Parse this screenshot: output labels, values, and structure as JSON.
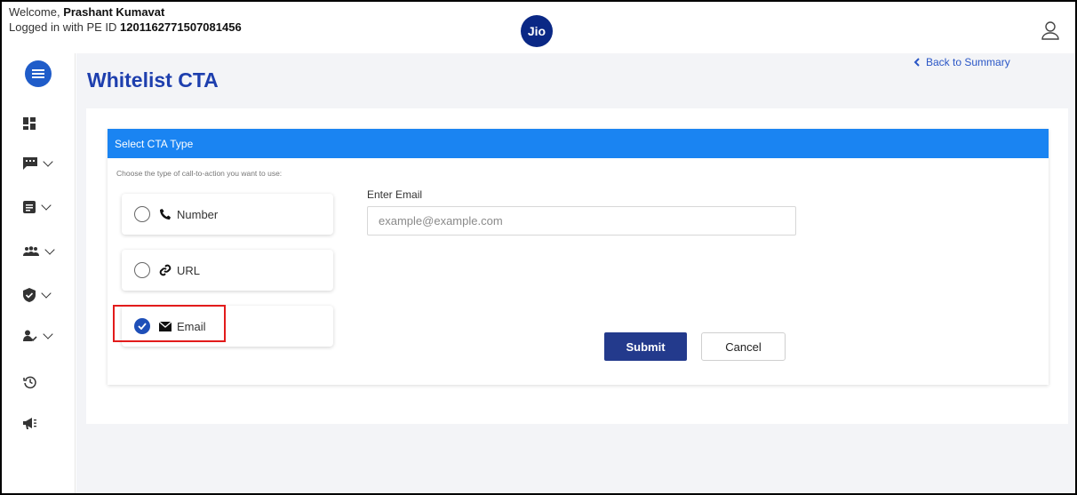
{
  "header": {
    "welcome_prefix": "Welcome,",
    "user_name": "Prashant Kumavat",
    "login_prefix": "Logged in with PE ID",
    "pe_id": "1201162771507081456",
    "logo_text": "Jio"
  },
  "sidebar": {
    "items": [
      {
        "icon": "dashboard-icon"
      },
      {
        "icon": "message-icon",
        "expandable": true
      },
      {
        "icon": "document-icon",
        "expandable": true
      },
      {
        "icon": "users-icon",
        "expandable": true
      },
      {
        "icon": "shield-check-icon",
        "expandable": true
      },
      {
        "icon": "user-check-icon",
        "expandable": true
      },
      {
        "icon": "history-icon"
      },
      {
        "icon": "megaphone-icon"
      }
    ]
  },
  "page": {
    "title": "Whitelist CTA",
    "back_link": "Back to Summary"
  },
  "form": {
    "section_title": "Select CTA Type",
    "hint": "Choose the type of call-to-action you want to use:",
    "options": [
      {
        "label": "Number",
        "icon": "phone-icon",
        "selected": false
      },
      {
        "label": "URL",
        "icon": "link-icon",
        "selected": false
      },
      {
        "label": "Email",
        "icon": "envelope-icon",
        "selected": true
      }
    ],
    "email_label": "Enter Email",
    "email_value": "",
    "email_placeholder": "example@example.com",
    "submit_label": "Submit",
    "cancel_label": "Cancel"
  },
  "colors": {
    "accent": "#1a84f2",
    "title": "#1e3fae",
    "submit": "#233a8c",
    "highlight": "#e21b1b"
  }
}
